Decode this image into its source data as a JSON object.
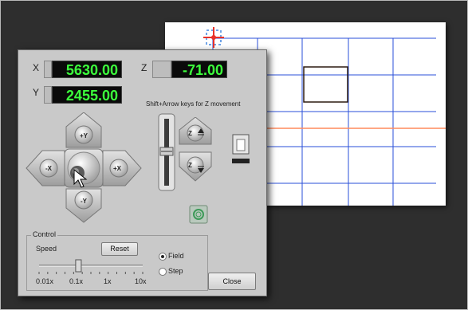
{
  "dro": {
    "x_label": "X",
    "x_value": "5630.00",
    "y_label": "Y",
    "y_value": "2455.00",
    "z_label": "Z",
    "z_value": "-71.00"
  },
  "hint_text": "Shift+Arrow keys for Z movement",
  "jog": {
    "plus_y": "+Y",
    "minus_y": "-Y",
    "minus_x": "-X",
    "plus_x": "+X",
    "z_up": "Z",
    "z_down": "Z"
  },
  "control": {
    "title": "Control",
    "speed_label": "Speed",
    "reset_label": "Reset",
    "speed_ticks": [
      "0.01x",
      "0.1x",
      "1x",
      "10x"
    ],
    "speed_fraction": 0.38,
    "mode_options": [
      {
        "label": "Field",
        "selected": true
      },
      {
        "label": "Step",
        "selected": false
      }
    ]
  },
  "close_label": "Close",
  "colors": {
    "lcd_text": "#3cff3c",
    "grid_line": "#2a4fd8",
    "guide_line": "#ff8a5c",
    "marker": "#e8322a"
  },
  "icons": {
    "tool_icon": "spindle-icon",
    "probe_icon": "target-icon",
    "cursor_icon": "mouse-cursor-icon"
  }
}
